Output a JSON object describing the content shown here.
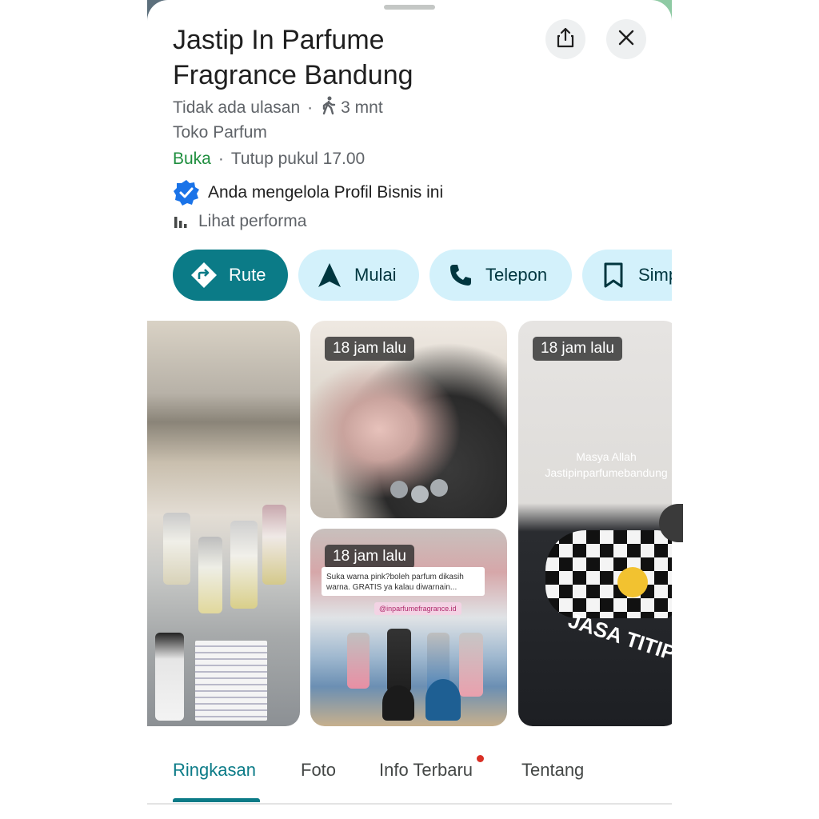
{
  "place": {
    "title": "Jastip In Parfume Fragrance Bandung",
    "reviews": "Tidak ada ulasan",
    "walk_time": "3 mnt",
    "category": "Toko Parfum",
    "open_status": "Buka",
    "closing": "Tutup pukul 17.00",
    "verified_text": "Anda mengelola Profil Bisnis ini",
    "performance_link": "Lihat performa"
  },
  "actions": [
    {
      "label": "Rute",
      "icon": "directions-icon"
    },
    {
      "label": "Mulai",
      "icon": "navigation-arrow-icon"
    },
    {
      "label": "Telepon",
      "icon": "phone-icon"
    },
    {
      "label": "Simpan",
      "icon": "bookmark-icon"
    }
  ],
  "photos": {
    "badge_2": "18 jam lalu",
    "badge_3": "18 jam lalu",
    "badge_4": "18 jam lalu",
    "story_caption": "Suka warna pink?boleh parfum dikasih warna. GRATIS ya kalau diwarnain...",
    "story_tag": "@inparfumefragrance.id",
    "overlay_line1": "Masya Allah",
    "overlay_line2": "Jastipinparfumebandung",
    "sign_text": "JASA TITIP"
  },
  "tabs": [
    {
      "label": "Ringkasan",
      "active": true
    },
    {
      "label": "Foto",
      "active": false
    },
    {
      "label": "Info Terbaru",
      "active": false,
      "notification_dot": true
    },
    {
      "label": "Tentang",
      "active": false
    }
  ],
  "colors": {
    "accent": "#0b7b87",
    "chip_bg": "#d3f1fb",
    "open_green": "#1e8e3e",
    "verified_blue": "#1a73e8"
  }
}
